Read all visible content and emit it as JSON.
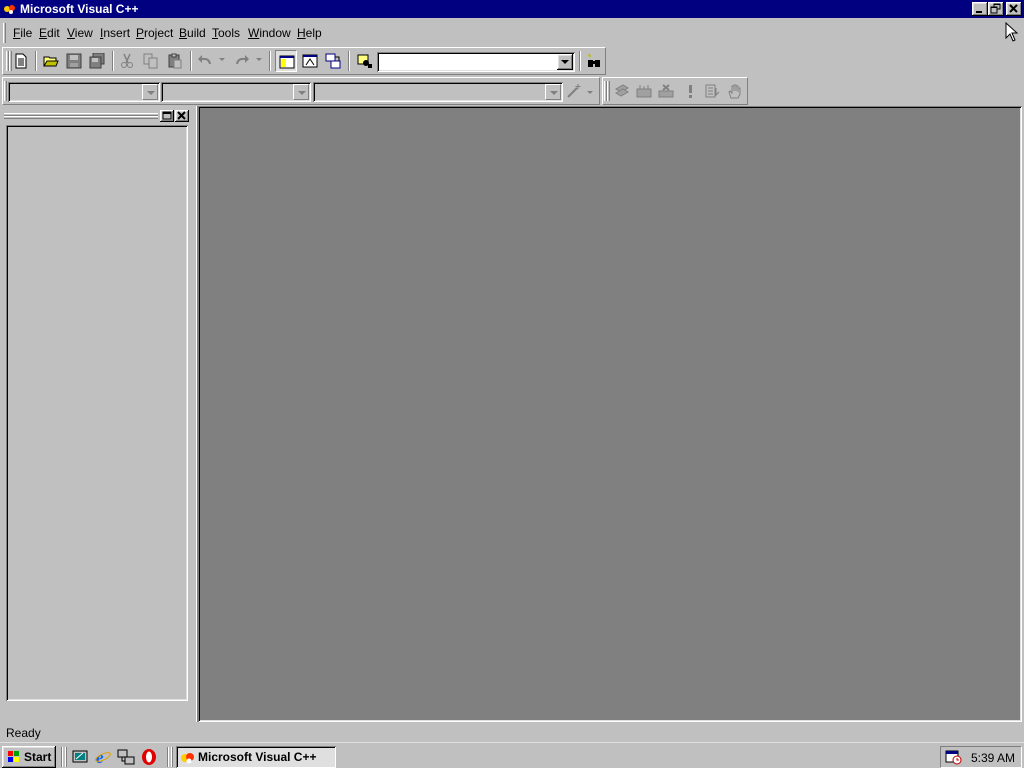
{
  "window": {
    "title": "Microsoft Visual C++",
    "minimize": "minimize",
    "restore": "restore",
    "close": "close"
  },
  "menu": {
    "items": [
      {
        "label": "File",
        "key": "F",
        "rest": "ile"
      },
      {
        "label": "Edit",
        "key": "E",
        "rest": "dit"
      },
      {
        "label": "View",
        "key": "V",
        "rest": "iew"
      },
      {
        "label": "Insert",
        "key": "I",
        "rest": "nsert"
      },
      {
        "label": "Project",
        "key": "P",
        "rest": "roject"
      },
      {
        "label": "Build",
        "key": "B",
        "rest": "uild"
      },
      {
        "label": "Tools",
        "key": "T",
        "rest": "ools"
      },
      {
        "label": "Window",
        "key": "W",
        "rest": "indow"
      },
      {
        "label": "Help",
        "key": "H",
        "rest": "elp"
      }
    ]
  },
  "toolbar": {
    "find_combo_value": "",
    "class_combo_value": "",
    "filter_combo_value": "",
    "members_combo_value": ""
  },
  "status": {
    "text": "Ready"
  },
  "taskbar": {
    "start_label": "Start",
    "task_label": "Microsoft Visual C++",
    "clock": "5:39 AM"
  },
  "colors": {
    "titlebar": "#000080",
    "face": "#c0c0c0",
    "mdi_background": "#808080"
  }
}
